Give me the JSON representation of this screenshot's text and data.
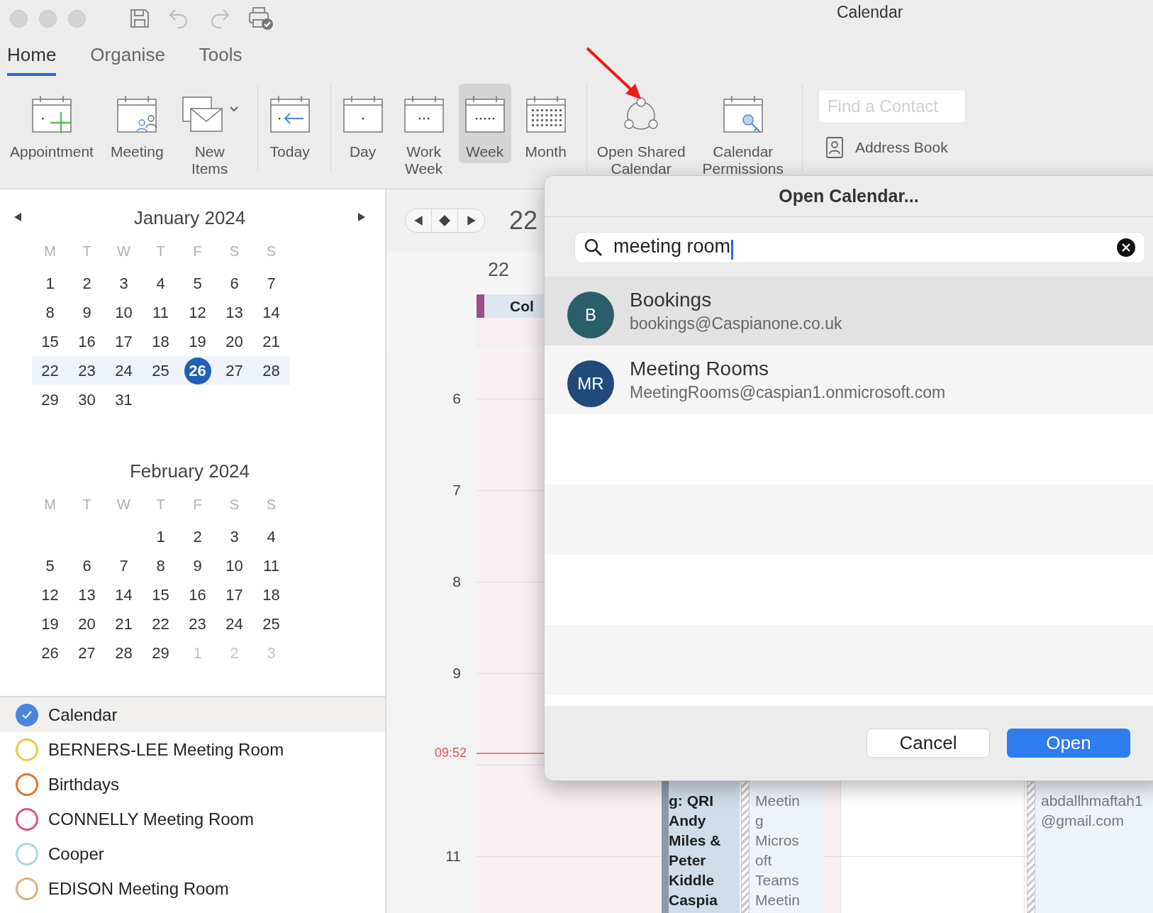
{
  "window": {
    "title": "Calendar"
  },
  "ribbon_tabs": [
    {
      "label": "Home",
      "selected": true
    },
    {
      "label": "Organise",
      "selected": false
    },
    {
      "label": "Tools",
      "selected": false
    }
  ],
  "ribbon_groups": [
    {
      "items": [
        {
          "kind": "appointment",
          "label": "Appointment",
          "selected": false
        },
        {
          "kind": "meeting",
          "label": "Meeting",
          "selected": false
        },
        {
          "kind": "new-items",
          "label": "New\nItems",
          "selected": false
        }
      ]
    },
    {
      "items": [
        {
          "kind": "today",
          "label": "Today",
          "selected": false
        }
      ]
    },
    {
      "items": [
        {
          "kind": "day",
          "label": "Day",
          "selected": false
        },
        {
          "kind": "work-week",
          "label": "Work\nWeek",
          "selected": false
        },
        {
          "kind": "week",
          "label": "Week",
          "selected": true
        },
        {
          "kind": "month",
          "label": "Month",
          "selected": false
        }
      ]
    },
    {
      "items": [
        {
          "kind": "shared",
          "label": "Open Shared\nCalendar",
          "selected": false
        },
        {
          "kind": "permissions",
          "label": "Calendar\nPermissions",
          "selected": false
        }
      ]
    }
  ],
  "contact_search": {
    "placeholder": "Find a Contact"
  },
  "address_book": {
    "label": "Address Book"
  },
  "mini_calendars": [
    {
      "title": "January 2024",
      "weekdays": [
        "M",
        "T",
        "W",
        "T",
        "F",
        "S",
        "S"
      ],
      "weeks": [
        {
          "selected": false,
          "days": [
            {
              "kind": "day",
              "label": "1"
            },
            {
              "kind": "day",
              "label": "2"
            },
            {
              "kind": "day",
              "label": "3"
            },
            {
              "kind": "day",
              "label": "4"
            },
            {
              "kind": "day",
              "label": "5"
            },
            {
              "kind": "day",
              "label": "6"
            },
            {
              "kind": "day",
              "label": "7"
            }
          ]
        },
        {
          "selected": false,
          "days": [
            {
              "kind": "day",
              "label": "8"
            },
            {
              "kind": "day",
              "label": "9"
            },
            {
              "kind": "day",
              "label": "10"
            },
            {
              "kind": "day",
              "label": "11"
            },
            {
              "kind": "day",
              "label": "12"
            },
            {
              "kind": "day",
              "label": "13"
            },
            {
              "kind": "day",
              "label": "14"
            }
          ]
        },
        {
          "selected": false,
          "days": [
            {
              "kind": "day",
              "label": "15"
            },
            {
              "kind": "day",
              "label": "16"
            },
            {
              "kind": "day",
              "label": "17"
            },
            {
              "kind": "day",
              "label": "18"
            },
            {
              "kind": "day",
              "label": "19"
            },
            {
              "kind": "day",
              "label": "20"
            },
            {
              "kind": "day",
              "label": "21"
            }
          ]
        },
        {
          "selected": true,
          "days": [
            {
              "kind": "day",
              "label": "22"
            },
            {
              "kind": "day",
              "label": "23"
            },
            {
              "kind": "day",
              "label": "24"
            },
            {
              "kind": "day",
              "label": "25"
            },
            {
              "kind": "today",
              "label": "26"
            },
            {
              "kind": "day",
              "label": "27"
            },
            {
              "kind": "day",
              "label": "28"
            }
          ]
        },
        {
          "selected": false,
          "days": [
            {
              "kind": "day",
              "label": "29"
            },
            {
              "kind": "day",
              "label": "30"
            },
            {
              "kind": "day",
              "label": "31"
            }
          ]
        }
      ]
    },
    {
      "title": "February 2024",
      "weekdays": [
        "M",
        "T",
        "W",
        "T",
        "F",
        "S",
        "S"
      ],
      "weeks": [
        {
          "selected": false,
          "days": [
            {
              "kind": "blank"
            },
            {
              "kind": "blank"
            },
            {
              "kind": "blank"
            },
            {
              "kind": "day",
              "label": "1"
            },
            {
              "kind": "day",
              "label": "2"
            },
            {
              "kind": "day",
              "label": "3"
            },
            {
              "kind": "day",
              "label": "4"
            }
          ]
        },
        {
          "selected": false,
          "days": [
            {
              "kind": "day",
              "label": "5"
            },
            {
              "kind": "day",
              "label": "6"
            },
            {
              "kind": "day",
              "label": "7"
            },
            {
              "kind": "day",
              "label": "8"
            },
            {
              "kind": "day",
              "label": "9"
            },
            {
              "kind": "day",
              "label": "10"
            },
            {
              "kind": "day",
              "label": "11"
            }
          ]
        },
        {
          "selected": false,
          "days": [
            {
              "kind": "day",
              "label": "12"
            },
            {
              "kind": "day",
              "label": "13"
            },
            {
              "kind": "day",
              "label": "14"
            },
            {
              "kind": "day",
              "label": "15"
            },
            {
              "kind": "day",
              "label": "16"
            },
            {
              "kind": "day",
              "label": "17"
            },
            {
              "kind": "day",
              "label": "18"
            }
          ]
        },
        {
          "selected": false,
          "days": [
            {
              "kind": "day",
              "label": "19"
            },
            {
              "kind": "day",
              "label": "20"
            },
            {
              "kind": "day",
              "label": "21"
            },
            {
              "kind": "day",
              "label": "22"
            },
            {
              "kind": "day",
              "label": "23"
            },
            {
              "kind": "day",
              "label": "24"
            },
            {
              "kind": "day",
              "label": "25"
            }
          ]
        },
        {
          "selected": false,
          "days": [
            {
              "kind": "day",
              "label": "26"
            },
            {
              "kind": "day",
              "label": "27"
            },
            {
              "kind": "day",
              "label": "28"
            },
            {
              "kind": "day",
              "label": "29"
            },
            {
              "kind": "other_month",
              "label": "1"
            },
            {
              "kind": "other_month",
              "label": "2"
            },
            {
              "kind": "other_month",
              "label": "3"
            }
          ]
        }
      ]
    }
  ],
  "calendars": [
    {
      "label": "Calendar",
      "checked": true,
      "selected": true,
      "color": "#4a86e0"
    },
    {
      "label": "BERNERS-LEE Meeting Room",
      "checked": false,
      "selected": false,
      "color": "#f0c550"
    },
    {
      "label": "Birthdays",
      "checked": false,
      "selected": false,
      "color": "#e0762a"
    },
    {
      "label": "CONNELLY Meeting Room",
      "checked": false,
      "selected": false,
      "color": "#e0508a"
    },
    {
      "label": "Cooper",
      "checked": false,
      "selected": false,
      "color": "#a6d8e2"
    },
    {
      "label": "EDISON Meeting Room",
      "checked": false,
      "selected": false,
      "color": "#d9b276"
    }
  ],
  "main": {
    "date_heading": "22",
    "day_header": "22",
    "all_day_events": [
      {
        "label": "Col",
        "color": "#9b4f86"
      }
    ],
    "hours": [
      {
        "kind": "label",
        "label": "6"
      },
      {
        "kind": "label",
        "label": "7"
      },
      {
        "kind": "label",
        "label": "8"
      },
      {
        "kind": "label",
        "label": "9",
        "now_line": "09:52"
      },
      {
        "kind": "covered"
      },
      {
        "kind": "label",
        "label": "11"
      }
    ],
    "events": [
      {
        "kind": "busy",
        "lines": [
          "g: QRI",
          "Andy",
          "Miles &",
          "Peter",
          "Kiddle",
          "Caspia"
        ]
      },
      {
        "kind": "tentative",
        "lines": [
          "Meetin",
          "g",
          "Micros",
          "oft",
          "Teams",
          "Meetin"
        ]
      },
      {
        "kind": "tentative",
        "lines": [
          "abdallhmaftah1",
          "@gmail.com"
        ]
      }
    ]
  },
  "dialog": {
    "title": "Open Calendar...",
    "search": {
      "value": "meeting room"
    },
    "results": [
      {
        "initials": "B",
        "name": "Bookings",
        "email": "bookings@Caspianone.co.uk",
        "color": "#2a5f6a",
        "selected": true
      },
      {
        "initials": "MR",
        "name": "Meeting Rooms",
        "email": "MeetingRooms@caspian1.onmicrosoft.com",
        "color": "#1f4a7a",
        "selected": false
      }
    ],
    "buttons": [
      {
        "label": "Cancel",
        "kind": "secondary"
      },
      {
        "label": "Open",
        "kind": "primary"
      }
    ]
  }
}
